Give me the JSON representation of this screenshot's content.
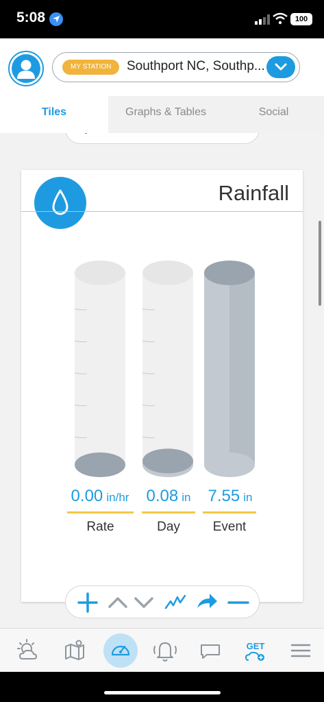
{
  "status": {
    "time": "5:08",
    "battery": "100"
  },
  "header": {
    "station_badge": "MY STATION",
    "station_name": "Southport NC, Southp..."
  },
  "tabs": [
    {
      "label": "Tiles",
      "active": true
    },
    {
      "label": "Graphs & Tables",
      "active": false
    },
    {
      "label": "Social",
      "active": false
    }
  ],
  "card": {
    "title": "Rainfall",
    "gauges": [
      {
        "value": "0.00",
        "unit": "in/hr",
        "label": "Rate",
        "fill_fraction": 0.0
      },
      {
        "value": "0.08",
        "unit": "in",
        "label": "Day",
        "fill_fraction": 0.02
      },
      {
        "value": "7.55",
        "unit": "in",
        "label": "Event",
        "fill_fraction": 1.0
      }
    ]
  },
  "controls": [
    "plus-icon",
    "chevron-up-icon",
    "chevron-down-icon",
    "trend-line-icon",
    "share-arrow-icon",
    "minus-icon"
  ],
  "bottom_nav": {
    "items": [
      "weather-icon",
      "map-icon",
      "dashboard-icon",
      "alerts-icon",
      "chat-icon",
      "get-icon",
      "menu-icon"
    ],
    "get_label": "GET",
    "active": "dashboard-icon"
  },
  "colors": {
    "accent": "#1e9be0",
    "badge": "#f0b43c",
    "underline": "#f3c846",
    "cylinder_empty": "#e6e6e6",
    "cylinder_fill": "#c2c9d0"
  }
}
